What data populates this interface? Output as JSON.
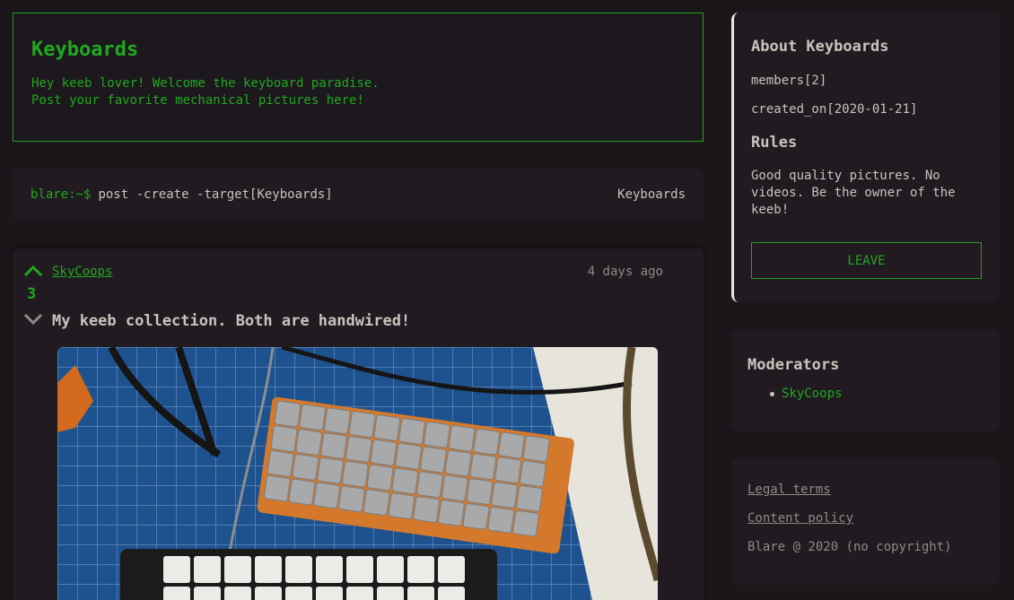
{
  "community": {
    "name": "Keyboards",
    "description_line1": "Hey keeb lover! Welcome the keyboard paradise.",
    "description_line2": "Post your favorite mechanical pictures here!"
  },
  "command_bar": {
    "prompt": "blare:~$",
    "command": "post -create -target[Keyboards]",
    "community_label": "Keyboards"
  },
  "post": {
    "author": "SkyCoops",
    "time": "4 days ago",
    "votes": "3",
    "title": "My keeb collection. Both are handwired!"
  },
  "about": {
    "heading": "About Keyboards",
    "members": "members[2]",
    "created_on": "created_on[2020-01-21]",
    "rules_heading": "Rules",
    "rules_text": "Good quality pictures. No videos. Be the owner of the keeb!",
    "leave_label": "LEAVE"
  },
  "moderators": {
    "heading": "Moderators",
    "items": [
      "SkyCoops"
    ]
  },
  "footer": {
    "legal": "Legal terms",
    "content_policy": "Content policy",
    "copyright": "Blare @ 2020 (no copyright)"
  },
  "colors": {
    "accent": "#1fa81f",
    "background": "#1a161a",
    "card": "#211b21",
    "text": "#c9c3bd",
    "muted": "#8f8a86"
  }
}
